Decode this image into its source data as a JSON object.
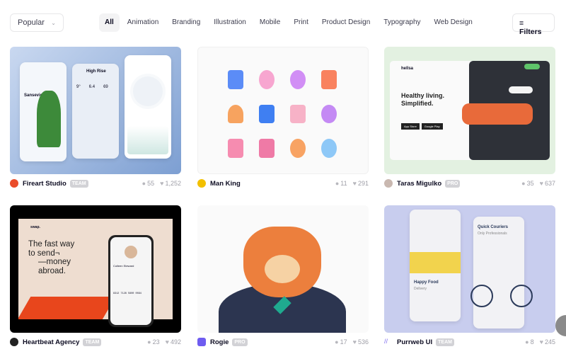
{
  "sort": {
    "label": "Popular"
  },
  "categories": [
    "All",
    "Animation",
    "Branding",
    "Illustration",
    "Mobile",
    "Print",
    "Product Design",
    "Typography",
    "Web Design"
  ],
  "active_category": "All",
  "filters_label": "Filters",
  "shots": [
    {
      "author": "Fireart Studio",
      "badge": "TEAM",
      "comments": "55",
      "likes": "1,252",
      "avatar_color": "#ea4c2a",
      "thumb": {
        "title": "High Rise",
        "subtitle": "Sansevieria",
        "values": [
          "9°",
          "6.4",
          "69"
        ]
      }
    },
    {
      "author": "Man King",
      "badge": "",
      "comments": "11",
      "likes": "291",
      "avatar_color": "#f2c000"
    },
    {
      "author": "Taras Migulko",
      "badge": "PRO",
      "comments": "35",
      "likes": "637",
      "avatar_color": "#c9b8b0",
      "thumb": {
        "brand": "hellsa",
        "headline": "Healthy living.",
        "headline2": "Simplified.",
        "btn1": "App Store",
        "btn2": "Google Play"
      }
    },
    {
      "author": "Heartbeat Agency",
      "badge": "TEAM",
      "comments": "23",
      "likes": "492",
      "avatar_color": "#222",
      "thumb": {
        "brand": "swap.",
        "l1": "The fast way",
        "l2": "to send¬",
        "l3": "—money",
        "l4": "abroad.",
        "person": "Colleen Steward",
        "card": "8312 7128 5600 0094"
      }
    },
    {
      "author": "Rogie",
      "badge": "PRO",
      "comments": "17",
      "likes": "536",
      "avatar_color": "#6e5cf0"
    },
    {
      "author": "Purrweb UI",
      "badge": "TEAM",
      "comments": "8",
      "likes": "245",
      "avatar_color": "#7b68ee",
      "thumb": {
        "a1": "Happy Food",
        "a2": "Delivery",
        "b1": "Quick Couriers",
        "b2": "Only Professionals"
      }
    }
  ]
}
